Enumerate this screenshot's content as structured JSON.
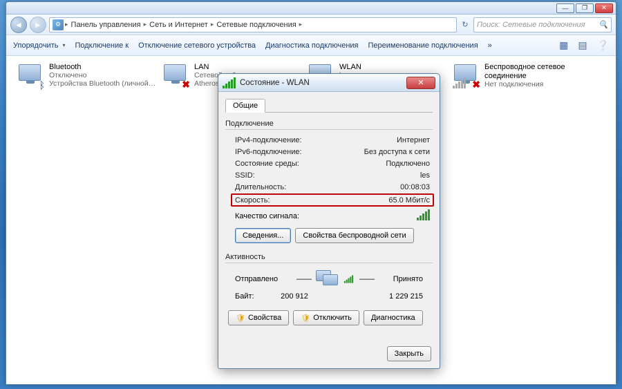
{
  "title_buttons": {
    "min": "—",
    "max": "❐",
    "close": "✕"
  },
  "breadcrumb": {
    "items": [
      "Панель управления",
      "Сеть и Интернет",
      "Сетевые подключения"
    ]
  },
  "search": {
    "placeholder": "Поиск: Сетевые подключения"
  },
  "toolbar": {
    "organize": "Упорядочить",
    "connect": "Подключение к",
    "disable": "Отключение сетевого устройства",
    "diagnose": "Диагностика подключения",
    "rename": "Переименование подключения",
    "more": "»"
  },
  "connections": [
    {
      "name": "Bluetooth",
      "status": "Отключено",
      "detail": "Устройства Bluetooth (личной с...",
      "overlay": "bt"
    },
    {
      "name": "LAN",
      "status": "Сетевой кабель не подключен",
      "detail": "Atheros",
      "overlay": "redx"
    },
    {
      "name": "WLAN",
      "status": "les",
      "detail": "",
      "overlay": "sig"
    },
    {
      "name": "Беспроводное сетевое соединение",
      "status": "Нет подключения",
      "detail": "",
      "overlay": "siggray",
      "twoLineName": true
    }
  ],
  "dialog": {
    "title": "Состояние - WLAN",
    "tab": "Общие",
    "group_conn": "Подключение",
    "rows": {
      "ipv4_l": "IPv4-подключение:",
      "ipv4_v": "Интернет",
      "ipv6_l": "IPv6-подключение:",
      "ipv6_v": "Без доступа к сети",
      "media_l": "Состояние среды:",
      "media_v": "Подключено",
      "ssid_l": "SSID:",
      "ssid_v": "les",
      "dur_l": "Длительность:",
      "dur_v": "00:08:03",
      "speed_l": "Скорость:",
      "speed_v": "65.0 Мбит/с",
      "sigq_l": "Качество сигнала:"
    },
    "btn_details": "Сведения...",
    "btn_wprops": "Свойства беспроводной сети",
    "group_act": "Активность",
    "sent": "Отправлено",
    "recv": "Принято",
    "bytes_l": "Байт:",
    "bytes_sent": "200 912",
    "bytes_recv": "1 229 215",
    "btn_props": "Свойства",
    "btn_disable": "Отключить",
    "btn_diag": "Диагностика",
    "btn_close": "Закрыть"
  }
}
